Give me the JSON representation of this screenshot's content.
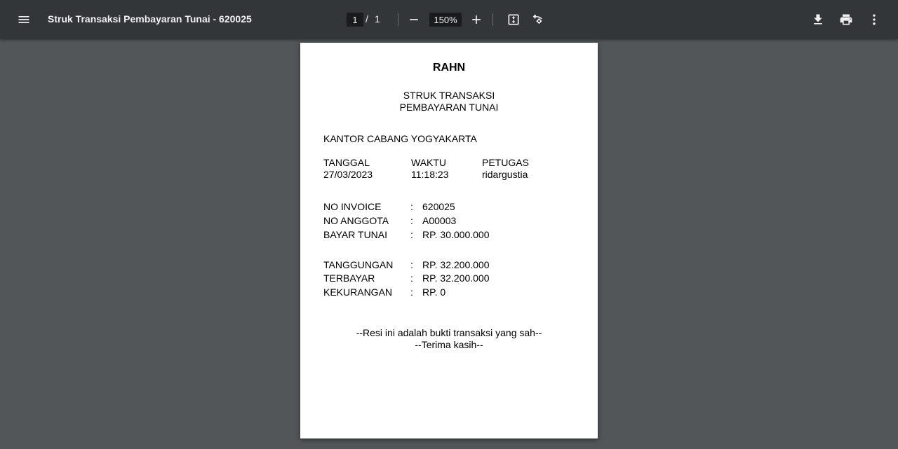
{
  "toolbar": {
    "title": "Struk Transaksi Pembayaran Tunai - 620025",
    "page_current": "1",
    "page_separator": "/",
    "page_total": "1",
    "zoom": "150%",
    "icons": {
      "menu": "menu-icon",
      "zoom_out": "minus-icon",
      "zoom_in": "plus-icon",
      "fit": "fit-to-page-icon",
      "rotate": "rotate-icon",
      "download": "download-icon",
      "print": "print-icon",
      "more": "more-vert-icon"
    }
  },
  "receipt": {
    "brand": "RAHN",
    "heading_line1": "STRUK TRANSAKSI",
    "heading_line2": "PEMBAYARAN TUNAI",
    "branch": "KANTOR CABANG YOGYAKARTA",
    "meta_headers": [
      "TANGGAL",
      "WAKTU",
      "PETUGAS"
    ],
    "meta_values": [
      "27/03/2023",
      "11:18:23",
      "ridargustia"
    ],
    "details": [
      {
        "label": "NO INVOICE",
        "colon": ":",
        "value": "620025"
      },
      {
        "label": "NO ANGGOTA",
        "colon": ":",
        "value": "A00003"
      },
      {
        "label": "BAYAR TUNAI",
        "colon": ":",
        "value": "RP. 30.000.000"
      }
    ],
    "summary": [
      {
        "label": "TANGGUNGAN",
        "colon": ":",
        "value": "RP. 32.200.000"
      },
      {
        "label": "TERBAYAR",
        "colon": ":",
        "value": "RP. 32.200.000"
      },
      {
        "label": "KEKURANGAN",
        "colon": ":",
        "value": "RP. 0"
      }
    ],
    "footer_line1": "--Resi ini adalah bukti transaksi yang sah--",
    "footer_line2": "--Terima kasih--"
  }
}
